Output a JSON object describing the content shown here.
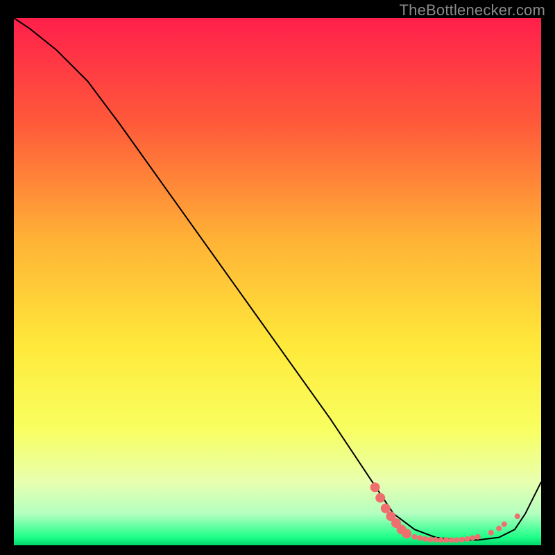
{
  "attribution": "TheBottlenecker.com",
  "chart_data": {
    "type": "line",
    "title": "",
    "xlabel": "",
    "ylabel": "",
    "xlim": [
      0,
      100
    ],
    "ylim": [
      0,
      100
    ],
    "background_gradient": {
      "stops": [
        {
          "offset": 0.0,
          "color": "#ff1f4b"
        },
        {
          "offset": 0.2,
          "color": "#ff5a3a"
        },
        {
          "offset": 0.42,
          "color": "#ffb236"
        },
        {
          "offset": 0.62,
          "color": "#ffe93a"
        },
        {
          "offset": 0.78,
          "color": "#f8ff60"
        },
        {
          "offset": 0.88,
          "color": "#e8ffb0"
        },
        {
          "offset": 0.94,
          "color": "#b4ffc0"
        },
        {
          "offset": 0.985,
          "color": "#1eff88"
        },
        {
          "offset": 1.0,
          "color": "#00d66a"
        }
      ]
    },
    "series": [
      {
        "name": "main-curve",
        "x": [
          0,
          3,
          8,
          14,
          20,
          30,
          40,
          50,
          60,
          68,
          72,
          76,
          80,
          84,
          88,
          92,
          95,
          97,
          100
        ],
        "y": [
          100,
          98,
          94,
          88,
          80,
          66,
          52,
          38,
          24,
          12,
          6,
          3,
          1.5,
          1,
          1,
          1.5,
          3,
          6,
          12
        ],
        "stroke": "#000000",
        "stroke_width": 2
      }
    ],
    "markers": [
      {
        "name": "valley-dots",
        "color": "#ef6f6f",
        "radius_small": 4,
        "radius_large": 7,
        "points": [
          {
            "x": 68.5,
            "y": 11.0,
            "r": "l"
          },
          {
            "x": 69.5,
            "y": 9.0,
            "r": "l"
          },
          {
            "x": 70.5,
            "y": 7.0,
            "r": "l"
          },
          {
            "x": 71.5,
            "y": 5.5,
            "r": "l"
          },
          {
            "x": 72.5,
            "y": 4.2,
            "r": "l"
          },
          {
            "x": 73.5,
            "y": 3.0,
            "r": "l"
          },
          {
            "x": 74.5,
            "y": 2.2,
            "r": "l"
          },
          {
            "x": 76.0,
            "y": 1.6,
            "r": "s"
          },
          {
            "x": 77.0,
            "y": 1.4,
            "r": "s"
          },
          {
            "x": 78.0,
            "y": 1.2,
            "r": "s"
          },
          {
            "x": 79.0,
            "y": 1.1,
            "r": "s"
          },
          {
            "x": 80.0,
            "y": 1.05,
            "r": "s"
          },
          {
            "x": 81.0,
            "y": 1.0,
            "r": "s"
          },
          {
            "x": 82.0,
            "y": 1.0,
            "r": "s"
          },
          {
            "x": 83.0,
            "y": 1.0,
            "r": "s"
          },
          {
            "x": 84.0,
            "y": 1.0,
            "r": "s"
          },
          {
            "x": 85.0,
            "y": 1.1,
            "r": "s"
          },
          {
            "x": 86.0,
            "y": 1.2,
            "r": "s"
          },
          {
            "x": 87.0,
            "y": 1.4,
            "r": "s"
          },
          {
            "x": 88.0,
            "y": 1.6,
            "r": "s"
          },
          {
            "x": 90.5,
            "y": 2.4,
            "r": "s"
          },
          {
            "x": 92.0,
            "y": 3.2,
            "r": "s"
          },
          {
            "x": 93.0,
            "y": 4.0,
            "r": "s"
          },
          {
            "x": 95.5,
            "y": 5.5,
            "r": "s"
          }
        ]
      }
    ]
  }
}
